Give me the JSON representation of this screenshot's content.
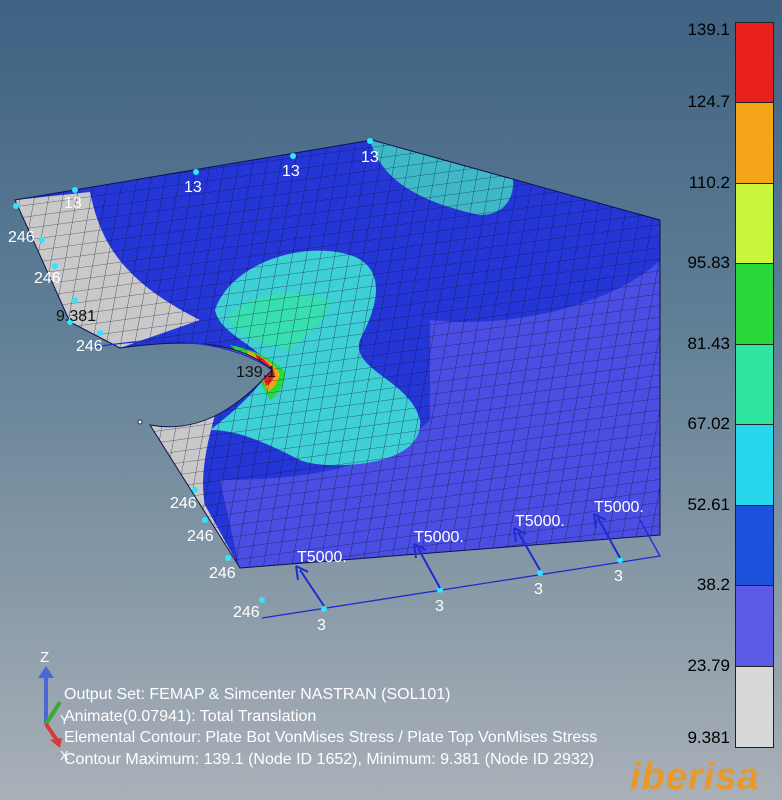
{
  "legend": {
    "values": [
      "139.1",
      "124.7",
      "110.2",
      "95.83",
      "81.43",
      "67.02",
      "52.61",
      "38.2",
      "23.79",
      "9.381"
    ],
    "colors": [
      "#e8201e",
      "#f5a418",
      "#c9f53a",
      "#2ad83c",
      "#2fe6a0",
      "#27d7ee",
      "#1c52dc",
      "#5a5ae6",
      "#d8d8d8"
    ]
  },
  "info": {
    "line1": "Output Set: FEMAP & Simcenter NASTRAN (SOL101)",
    "line2": "Animate(0.07941): Total Translation",
    "line3": "Elemental Contour: Plate Bot VonMises Stress / Plate Top VonMises Stress",
    "line4": "Contour Maximum: 139.1 (Node ID 1652), Minimum: 9.381 (Node ID 2932)"
  },
  "model": {
    "constraint_top": "13",
    "constraint_left": "246",
    "constraint_bottom": "3",
    "load_label": "T5000.",
    "max_label": "139.1",
    "min_label": "9.381"
  },
  "triad": {
    "z": "Z",
    "y": "Y",
    "x": "X"
  },
  "brand": "iberisa"
}
